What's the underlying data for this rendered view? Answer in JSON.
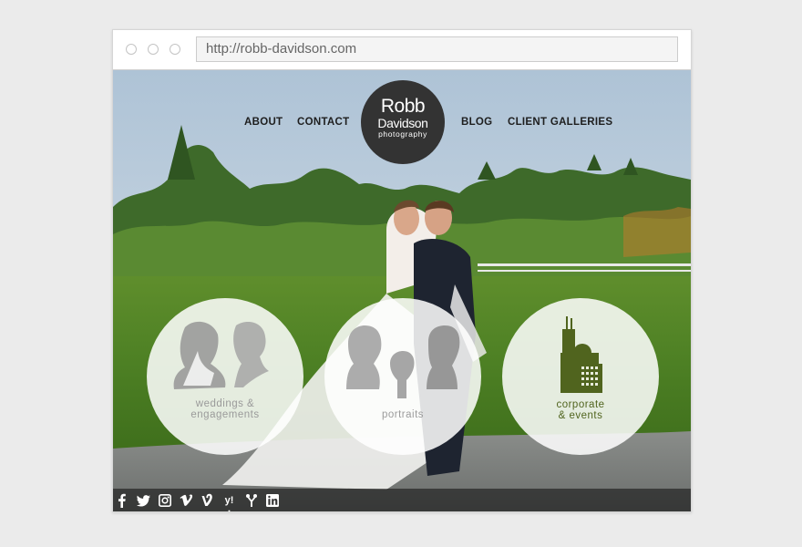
{
  "browser": {
    "url": "http://robb-davidson.com"
  },
  "nav": {
    "items": [
      "ABOUT",
      "CONTACT",
      "BLOG",
      "CLIENT GALLERIES"
    ]
  },
  "logo": {
    "line1": "Robb",
    "line2": "Davidson",
    "line3": "photography"
  },
  "services": [
    {
      "line1": "weddings &",
      "line2": "engagements",
      "icon": "couple-silhouette-icon"
    },
    {
      "line1": "portraits",
      "icon": "family-silhouette-icon"
    },
    {
      "line1": "corporate",
      "line2": "& events",
      "icon": "city-skyline-icon"
    }
  ],
  "social": {
    "items": [
      "facebook-icon",
      "twitter-icon",
      "instagram-icon",
      "vimeo-icon",
      "vine-icon",
      "yelp-icon",
      "wedding-wire-icon",
      "linkedin-icon"
    ]
  },
  "colors": {
    "logo_bg": "#333333",
    "nav_text": "#1e1e1e",
    "weddings_label": "#9a9a9a",
    "portraits_label": "#9c9c9c",
    "corporate_accent": "#50641e"
  }
}
